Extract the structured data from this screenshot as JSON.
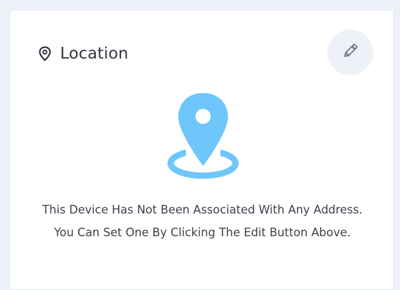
{
  "card": {
    "title": "Location",
    "title_icon": "location-pin-icon",
    "edit_icon": "pencil-icon",
    "illustration_icon": "map-pin-icon",
    "empty_message": "This Device Has Not Been Associated With Any Address. You Can Set One By Clicking The Edit Button Above."
  },
  "colors": {
    "accent": "#6ec6fb",
    "title": "#2f3540",
    "text": "#3b414c",
    "edit_button_bg": "#eef1f7",
    "page_bg": "#eef1f8"
  }
}
